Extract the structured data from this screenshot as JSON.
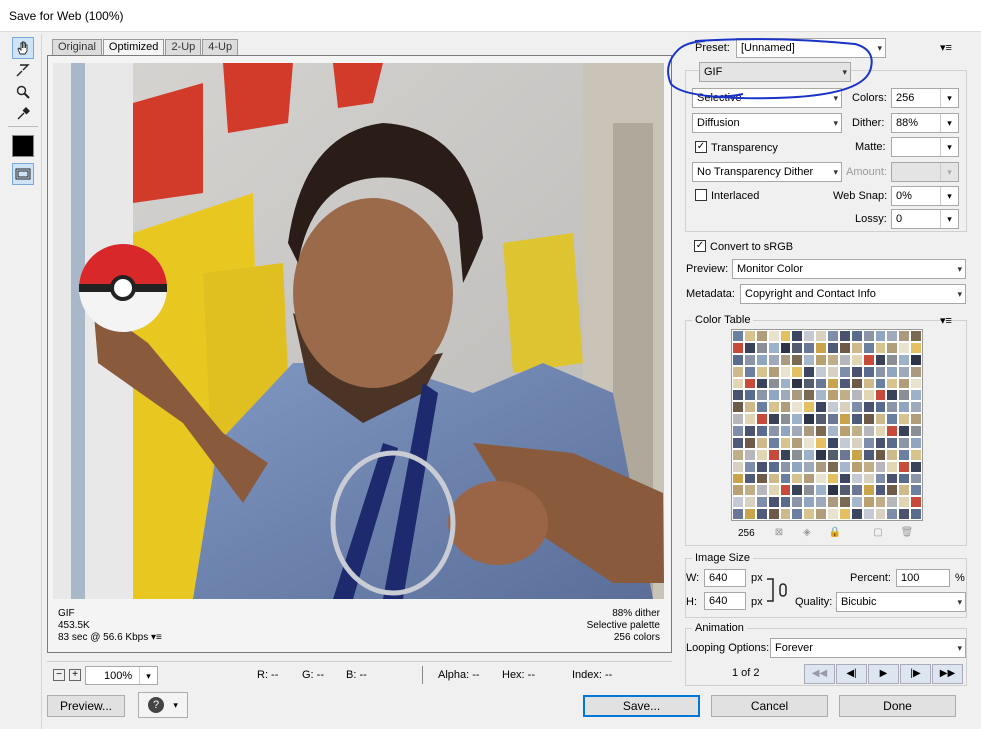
{
  "window": {
    "title": "Save for Web (100%)"
  },
  "toolbar": {
    "tools": [
      "hand-tool",
      "slice-select-tool",
      "zoom-tool",
      "eyedropper-tool",
      "eyedropper-color",
      "toggle-slices-visibility"
    ]
  },
  "tabs": [
    "Original",
    "Optimized",
    "2-Up",
    "4-Up"
  ],
  "active_tab": "Optimized",
  "preview_info": {
    "format": "GIF",
    "size": "453.5K",
    "time": "83 sec @ 56.6 Kbps",
    "dither": "88% dither",
    "palette": "Selective palette",
    "colors": "256 colors"
  },
  "status_bar": {
    "zoom": "100%",
    "r": "R: --",
    "g": "G: --",
    "b": "B: --",
    "alpha": "Alpha: --",
    "hex": "Hex: --",
    "index": "Index: --"
  },
  "settings": {
    "preset_label": "Preset:",
    "preset_value": "[Unnamed]",
    "format": "GIF",
    "reduction": "Selective",
    "colors_label": "Colors:",
    "colors_value": "256",
    "dither_algo": "Diffusion",
    "dither_label": "Dither:",
    "dither_value": "88%",
    "transparency_label": "Transparency",
    "transparency_checked": true,
    "matte_label": "Matte:",
    "transparency_dither": "No Transparency Dither",
    "amount_label": "Amount:",
    "interlaced_label": "Interlaced",
    "interlaced_checked": false,
    "websnap_label": "Web Snap:",
    "websnap_value": "0%",
    "lossy_label": "Lossy:",
    "lossy_value": "0",
    "srgb_label": "Convert to sRGB",
    "srgb_checked": true,
    "preview_label": "Preview:",
    "preview_value": "Monitor Color",
    "metadata_label": "Metadata:",
    "metadata_value": "Copyright and Contact Info"
  },
  "color_table": {
    "title": "Color Table",
    "count": "256",
    "colors": [
      "#6b7fa0",
      "#8a8f96",
      "#a99a80",
      "#3d4660",
      "#c9a44a",
      "#b7b7bb",
      "#5a6c8e",
      "#d6c38e",
      "#9bb2c9",
      "#7a6a52",
      "#c4c9d4",
      "#4f5a78",
      "#e0d6b4",
      "#8c94a8",
      "#b29d7a",
      "#2e3448",
      "#a6b7cc",
      "#d8d0c0",
      "#6d5a48",
      "#c84a3a",
      "#8fa5c0",
      "#e9e2cf",
      "#545c70",
      "#b8a070",
      "#7d8daa",
      "#cdb98a",
      "#3a4258",
      "#9fa9ba",
      "#e4c062",
      "#6a7896",
      "#c0ae88",
      "#4a5270"
    ]
  },
  "image_size": {
    "title": "Image Size",
    "w_label": "W:",
    "w_value": "640",
    "w_unit": "px",
    "h_label": "H:",
    "h_value": "640",
    "h_unit": "px",
    "percent_label": "Percent:",
    "percent_value": "100",
    "percent_unit": "%",
    "quality_label": "Quality:",
    "quality_value": "Bicubic"
  },
  "animation": {
    "title": "Animation",
    "looping_label": "Looping Options:",
    "looping_value": "Forever",
    "frame": "1 of 2"
  },
  "buttons": {
    "preview": "Preview...",
    "save": "Save...",
    "cancel": "Cancel",
    "done": "Done"
  },
  "colors": {
    "annotation_ink": "#1a33c7",
    "accent": "#0078d7"
  }
}
